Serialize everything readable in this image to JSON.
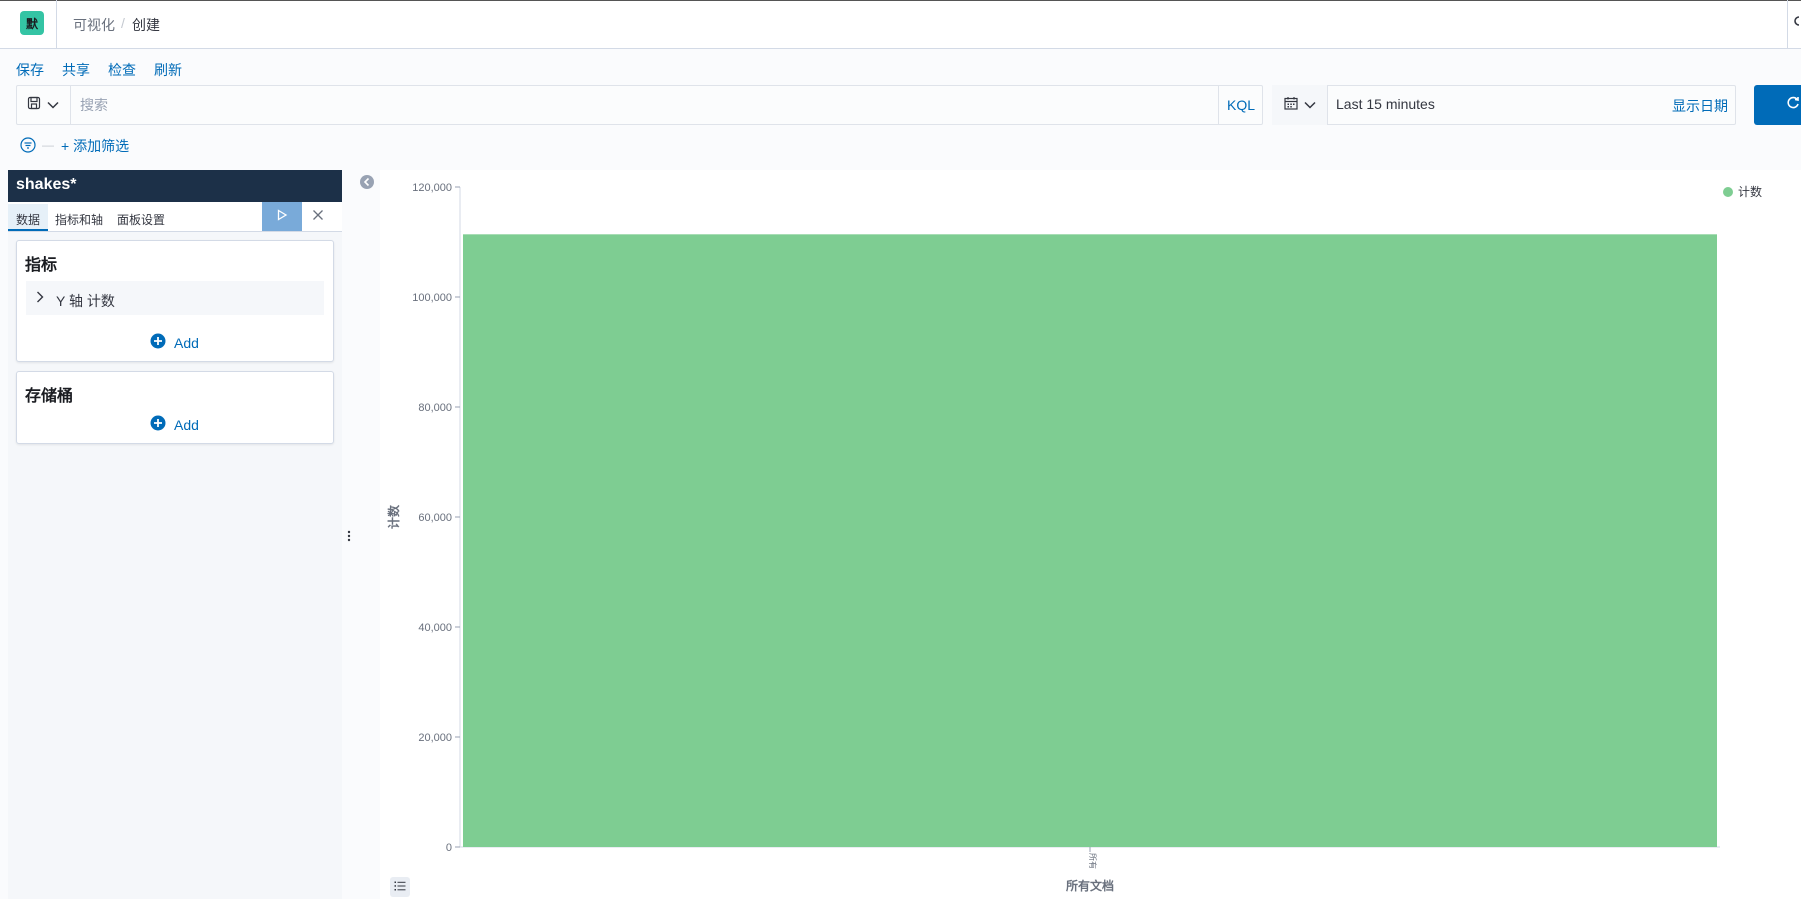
{
  "header": {
    "logo_glyph": "默",
    "breadcrumbs": [
      "可视化",
      "创建"
    ],
    "separator": "/"
  },
  "toolbar": {
    "save": "保存",
    "share": "共享",
    "inspect": "检查",
    "refresh": "刷新"
  },
  "query": {
    "placeholder": "搜索",
    "language": "KQL"
  },
  "date": {
    "range": "Last 15 minutes",
    "show_dates": "显示日期"
  },
  "filters": {
    "dash": "—",
    "add_filter": "+ 添加筛选"
  },
  "sidebar": {
    "index_pattern": "shakes*",
    "tabs": [
      "数据",
      "指标和轴",
      "面板设置"
    ],
    "metrics_title": "指标",
    "metric_item": "Y 轴 计数",
    "add_label": "Add",
    "buckets_title": "存储桶"
  },
  "colors": {
    "accent": "#006bb8",
    "bar": "#7ecd92",
    "sidebar_header": "#1c3048"
  },
  "chart_data": {
    "type": "bar",
    "categories": [
      "所有"
    ],
    "series": [
      {
        "name": "计数",
        "values": [
          111396
        ]
      }
    ],
    "xlabel": "所有文档",
    "ylabel": "计数",
    "ylim": [
      0,
      120000
    ],
    "yticks": [
      0,
      20000,
      40000,
      60000,
      80000,
      100000,
      120000
    ],
    "ytick_labels": [
      "0",
      "20,000",
      "40,000",
      "60,000",
      "80,000",
      "100,000",
      "120,000"
    ],
    "legend": "top-right",
    "grid": false
  }
}
